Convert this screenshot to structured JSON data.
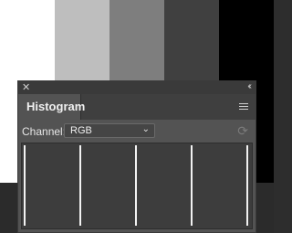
{
  "canvas": {
    "bars": [
      {
        "color": "#ffffff"
      },
      {
        "color": "#bebebe"
      },
      {
        "color": "#7e7e7e"
      },
      {
        "color": "#404040"
      },
      {
        "color": "#000000"
      }
    ]
  },
  "panel": {
    "close_icon": "close-icon",
    "collapse_icon": "double-chevron-icon",
    "tab_label": "Histogram",
    "menu_icon": "hamburger-menu-icon",
    "channel_label": "Channel:",
    "channel_value": "RGB",
    "refresh_icon": "refresh-icon",
    "histogram_levels": [
      0,
      63,
      127,
      191,
      255
    ]
  }
}
